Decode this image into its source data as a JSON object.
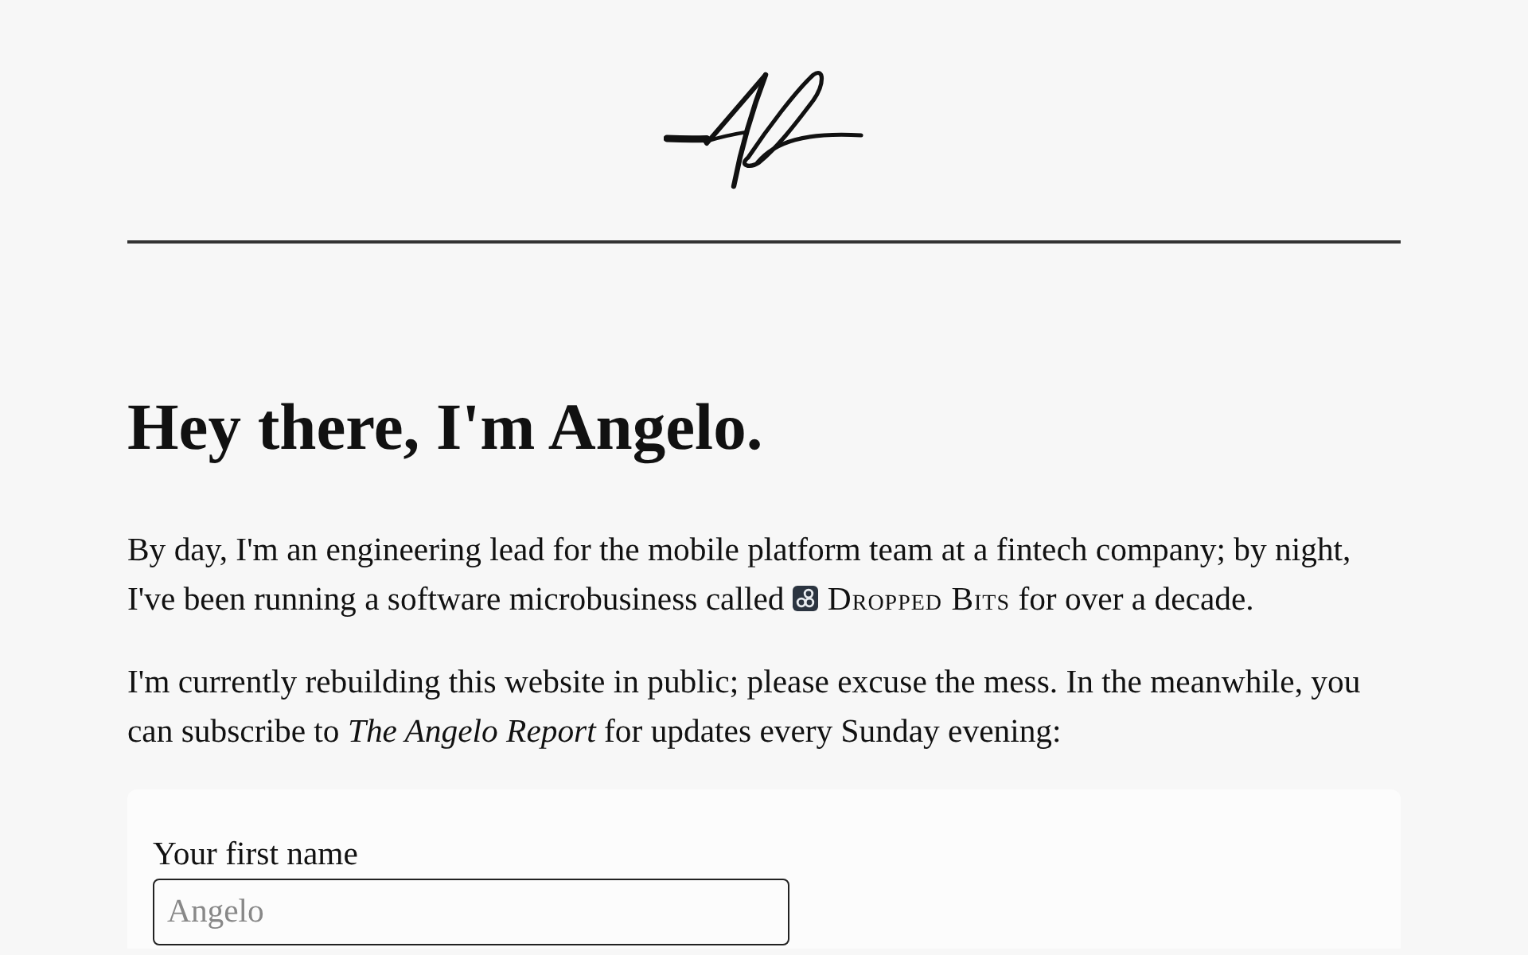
{
  "heading": "Hey there, I'm Angelo.",
  "paragraphs": [
    {
      "parts": [
        {
          "kind": "text",
          "text": "By day, I'm an engineering lead for the mobile platform team at a fintech company; by night, I've been running a software microbusiness called"
        },
        {
          "kind": "brand",
          "text": "Dropped Bits"
        },
        {
          "kind": "text",
          "text": "for over a decade."
        }
      ]
    },
    {
      "parts": [
        {
          "kind": "text",
          "text": "I'm currently rebuilding this website in public; please excuse the mess. In the meanwhile, you can subscribe to *The Angelo Report* for updates every Sunday evening:"
        }
      ]
    }
  ],
  "subscribe_form": {
    "fields": [
      {
        "label": "Your first name",
        "placeholder": "Angelo"
      }
    ]
  }
}
